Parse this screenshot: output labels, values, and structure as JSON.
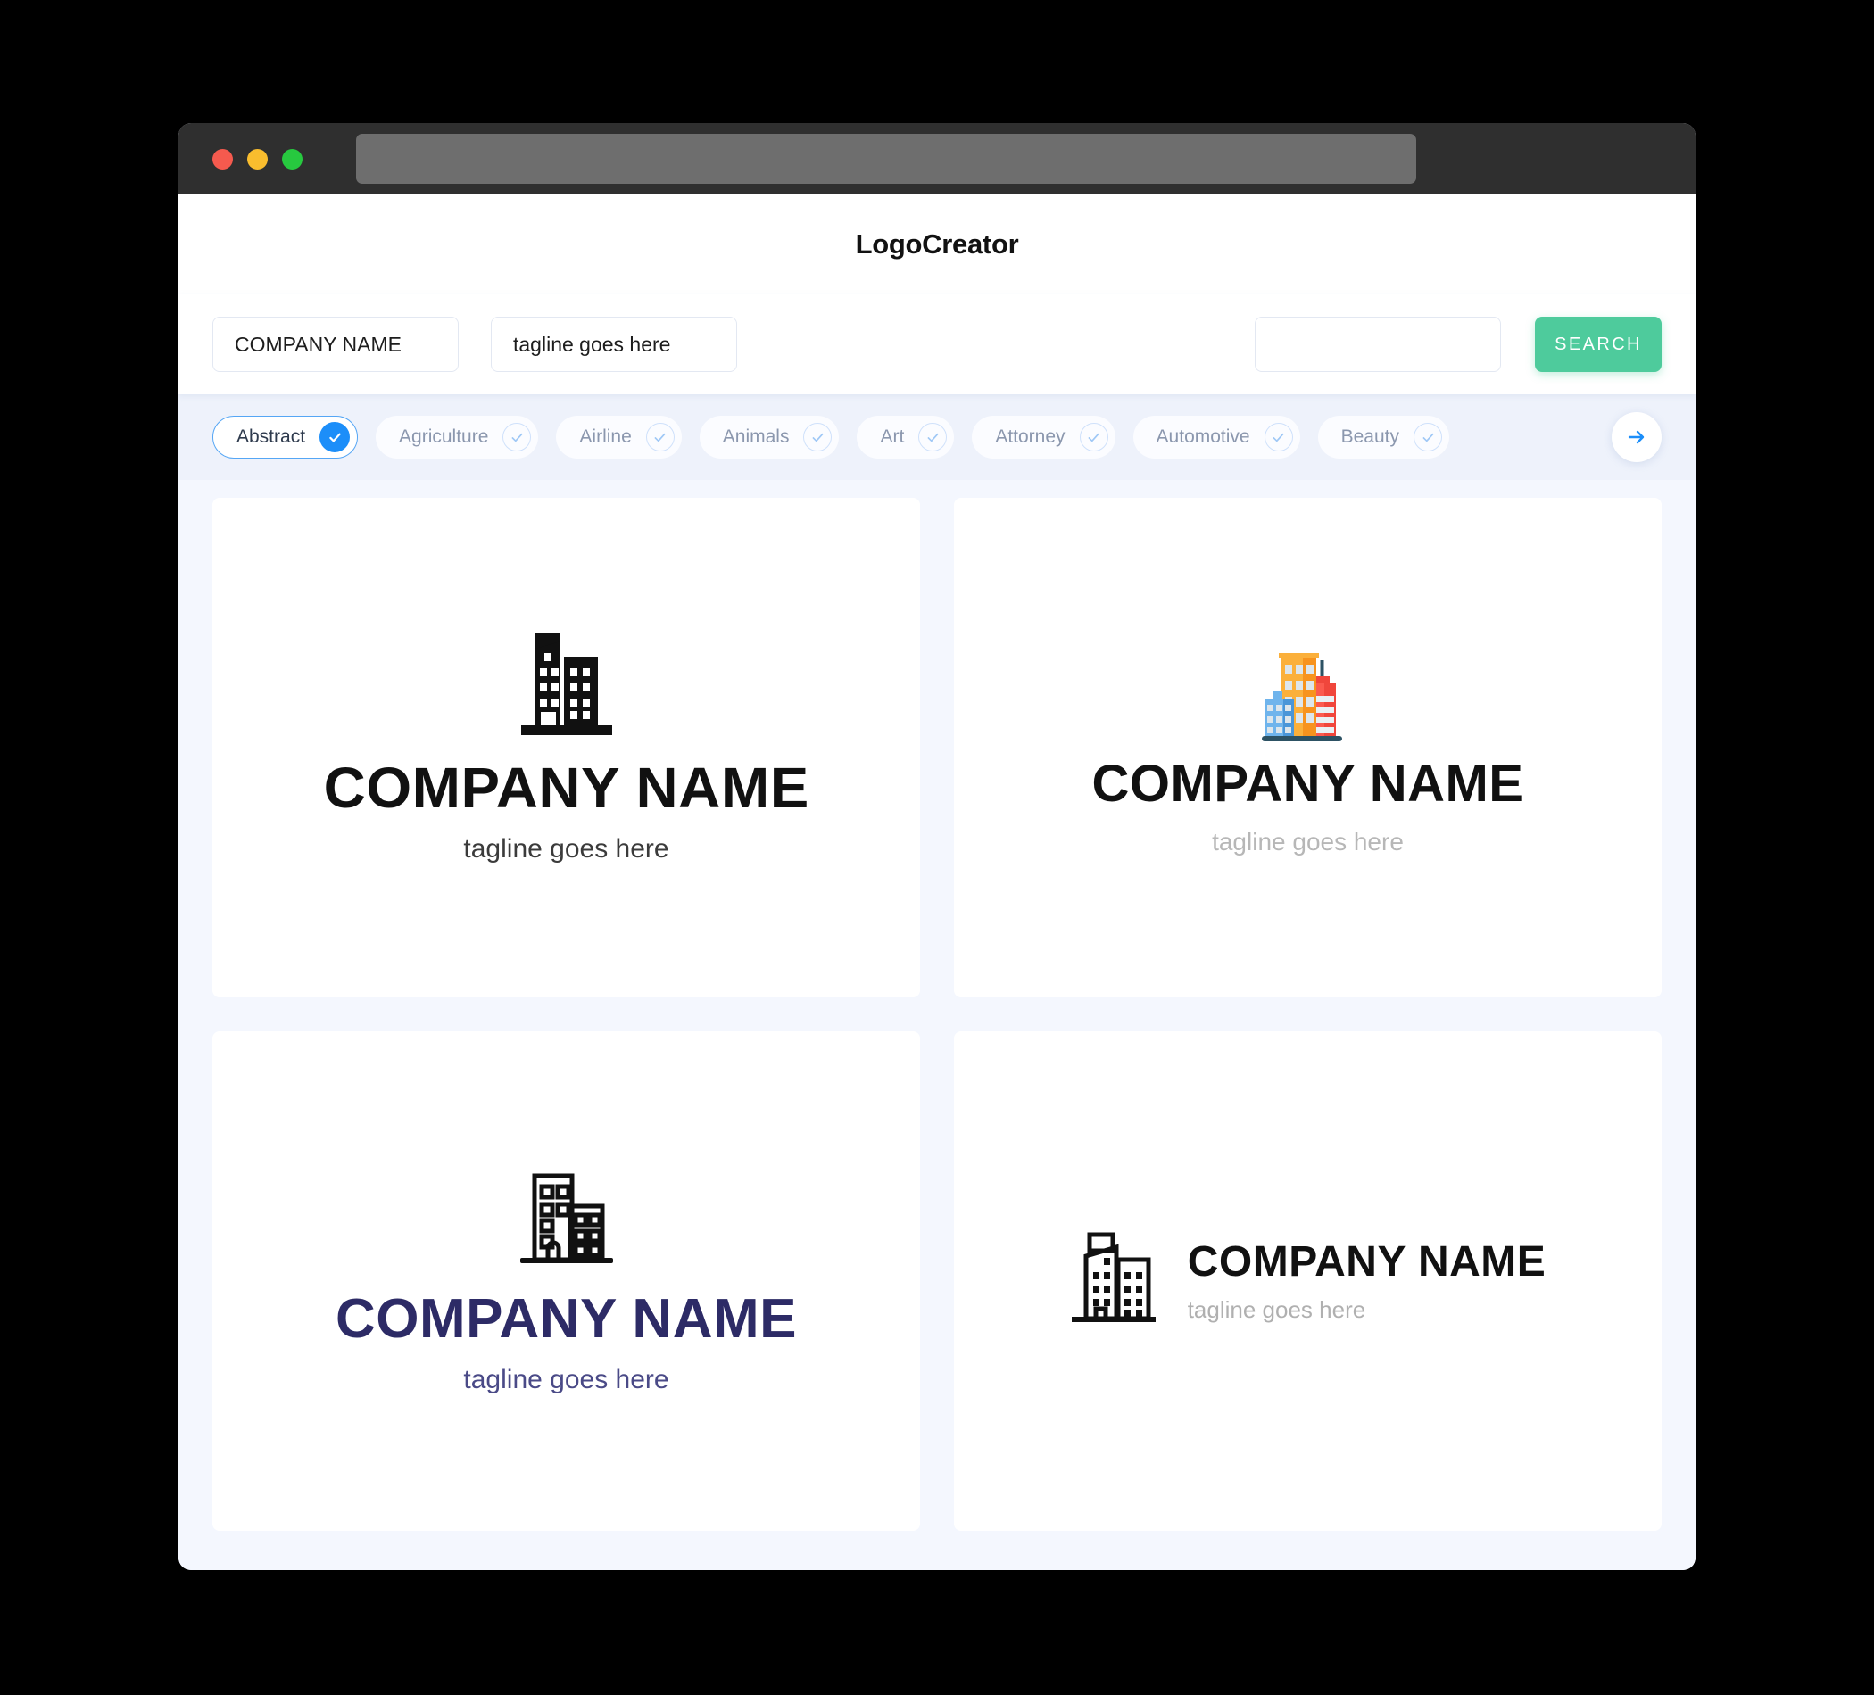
{
  "window": {
    "traffic_lights": [
      "close",
      "minimize",
      "maximize"
    ],
    "url_value": ""
  },
  "header": {
    "title": "LogoCreator"
  },
  "search": {
    "company_value": "COMPANY NAME",
    "company_placeholder": "COMPANY NAME",
    "tagline_value": "tagline goes here",
    "tagline_placeholder": "tagline goes here",
    "keyword_value": "",
    "keyword_placeholder": "",
    "button_label": "SEARCH",
    "button_color": "#4ecb9c"
  },
  "categories": {
    "active_color": "#1c8ef9",
    "items": [
      {
        "label": "Abstract",
        "selected": true
      },
      {
        "label": "Agriculture",
        "selected": false
      },
      {
        "label": "Airline",
        "selected": false
      },
      {
        "label": "Animals",
        "selected": false
      },
      {
        "label": "Art",
        "selected": false
      },
      {
        "label": "Attorney",
        "selected": false
      },
      {
        "label": "Automotive",
        "selected": false
      },
      {
        "label": "Beauty",
        "selected": false
      }
    ],
    "next_icon": "arrow-right-icon"
  },
  "results": {
    "cards": [
      {
        "icon": "building-solid-icon",
        "name": "COMPANY NAME",
        "tagline": "tagline goes here",
        "name_color": "#111111",
        "tagline_color": "#3b3b3b",
        "layout": "stacked"
      },
      {
        "icon": "buildings-color-icon",
        "name": "COMPANY NAME",
        "tagline": "tagline goes here",
        "name_color": "#111111",
        "tagline_color": "#b7b7b7",
        "layout": "stacked",
        "palette": {
          "orange": "#fbb03b",
          "orange_dark": "#f7931e",
          "red": "#f0463c",
          "red_light": "#fb5a4f",
          "blue": "#5ca9e8",
          "blue_dark": "#4a96d8",
          "base": "#2d5264",
          "window": "#dde6ec"
        }
      },
      {
        "icon": "building-outline-icon",
        "name": "COMPANY NAME",
        "tagline": "tagline goes here",
        "name_color": "#2d2b66",
        "tagline_color": "#4a4a87",
        "layout": "stacked"
      },
      {
        "icon": "building-outline-wide-icon",
        "name": "COMPANY NAME",
        "tagline": "tagline goes here",
        "name_color": "#111111",
        "tagline_color": "#b0b0b0",
        "layout": "horizontal"
      }
    ]
  }
}
